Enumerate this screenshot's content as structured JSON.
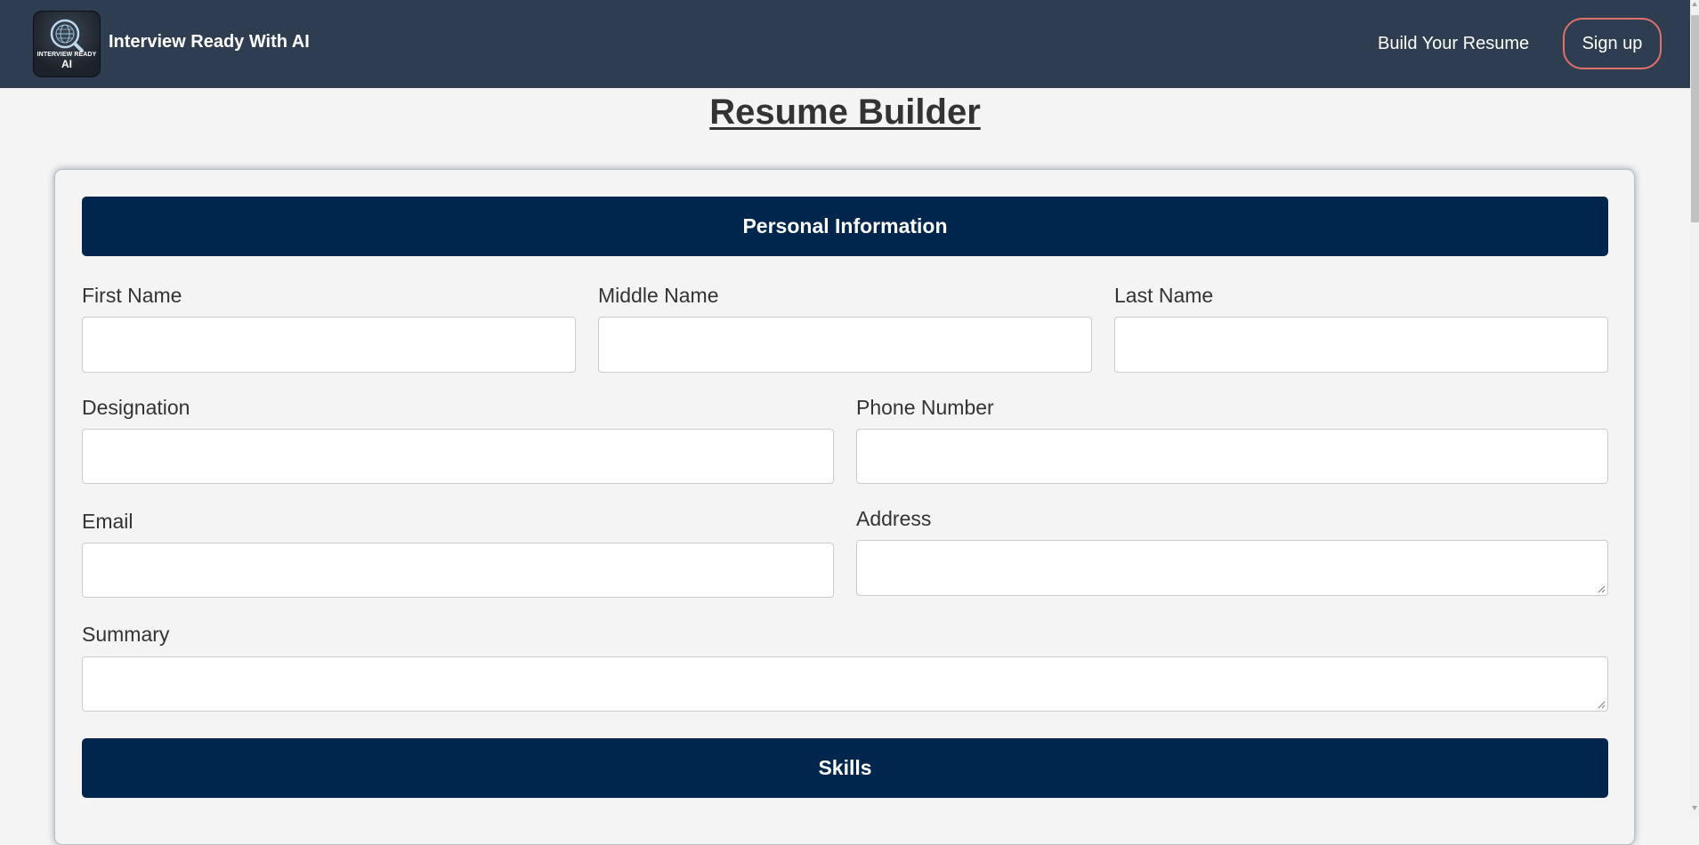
{
  "navbar": {
    "logo_line1": "INTERVIEW READY",
    "logo_line2": "AI",
    "brand_name": "Interview Ready With AI",
    "nav_link": "Build Your Resume",
    "signup_label": "Sign up",
    "colors": {
      "background": "#2e3d50",
      "signup_border": "#e0706c"
    }
  },
  "page": {
    "title": "Resume Builder"
  },
  "form": {
    "personal_section": {
      "header": "Personal Information",
      "fields": {
        "first_name": {
          "label": "First Name",
          "value": "",
          "placeholder": ""
        },
        "middle_name": {
          "label": "Middle Name",
          "value": "",
          "placeholder": ""
        },
        "last_name": {
          "label": "Last Name",
          "value": "",
          "placeholder": ""
        },
        "designation": {
          "label": "Designation",
          "value": "",
          "placeholder": ""
        },
        "phone_number": {
          "label": "Phone Number",
          "value": "",
          "placeholder": ""
        },
        "email": {
          "label": "Email",
          "value": "",
          "placeholder": ""
        },
        "address": {
          "label": "Address",
          "value": "",
          "placeholder": ""
        },
        "summary": {
          "label": "Summary",
          "value": "",
          "placeholder": ""
        }
      }
    },
    "skills_section": {
      "header": "Skills"
    },
    "colors": {
      "section_header": "#00264d"
    }
  },
  "icons": {
    "logo": "magnifier-globe-icon",
    "textarea_resize": "resize-grip-icon"
  }
}
